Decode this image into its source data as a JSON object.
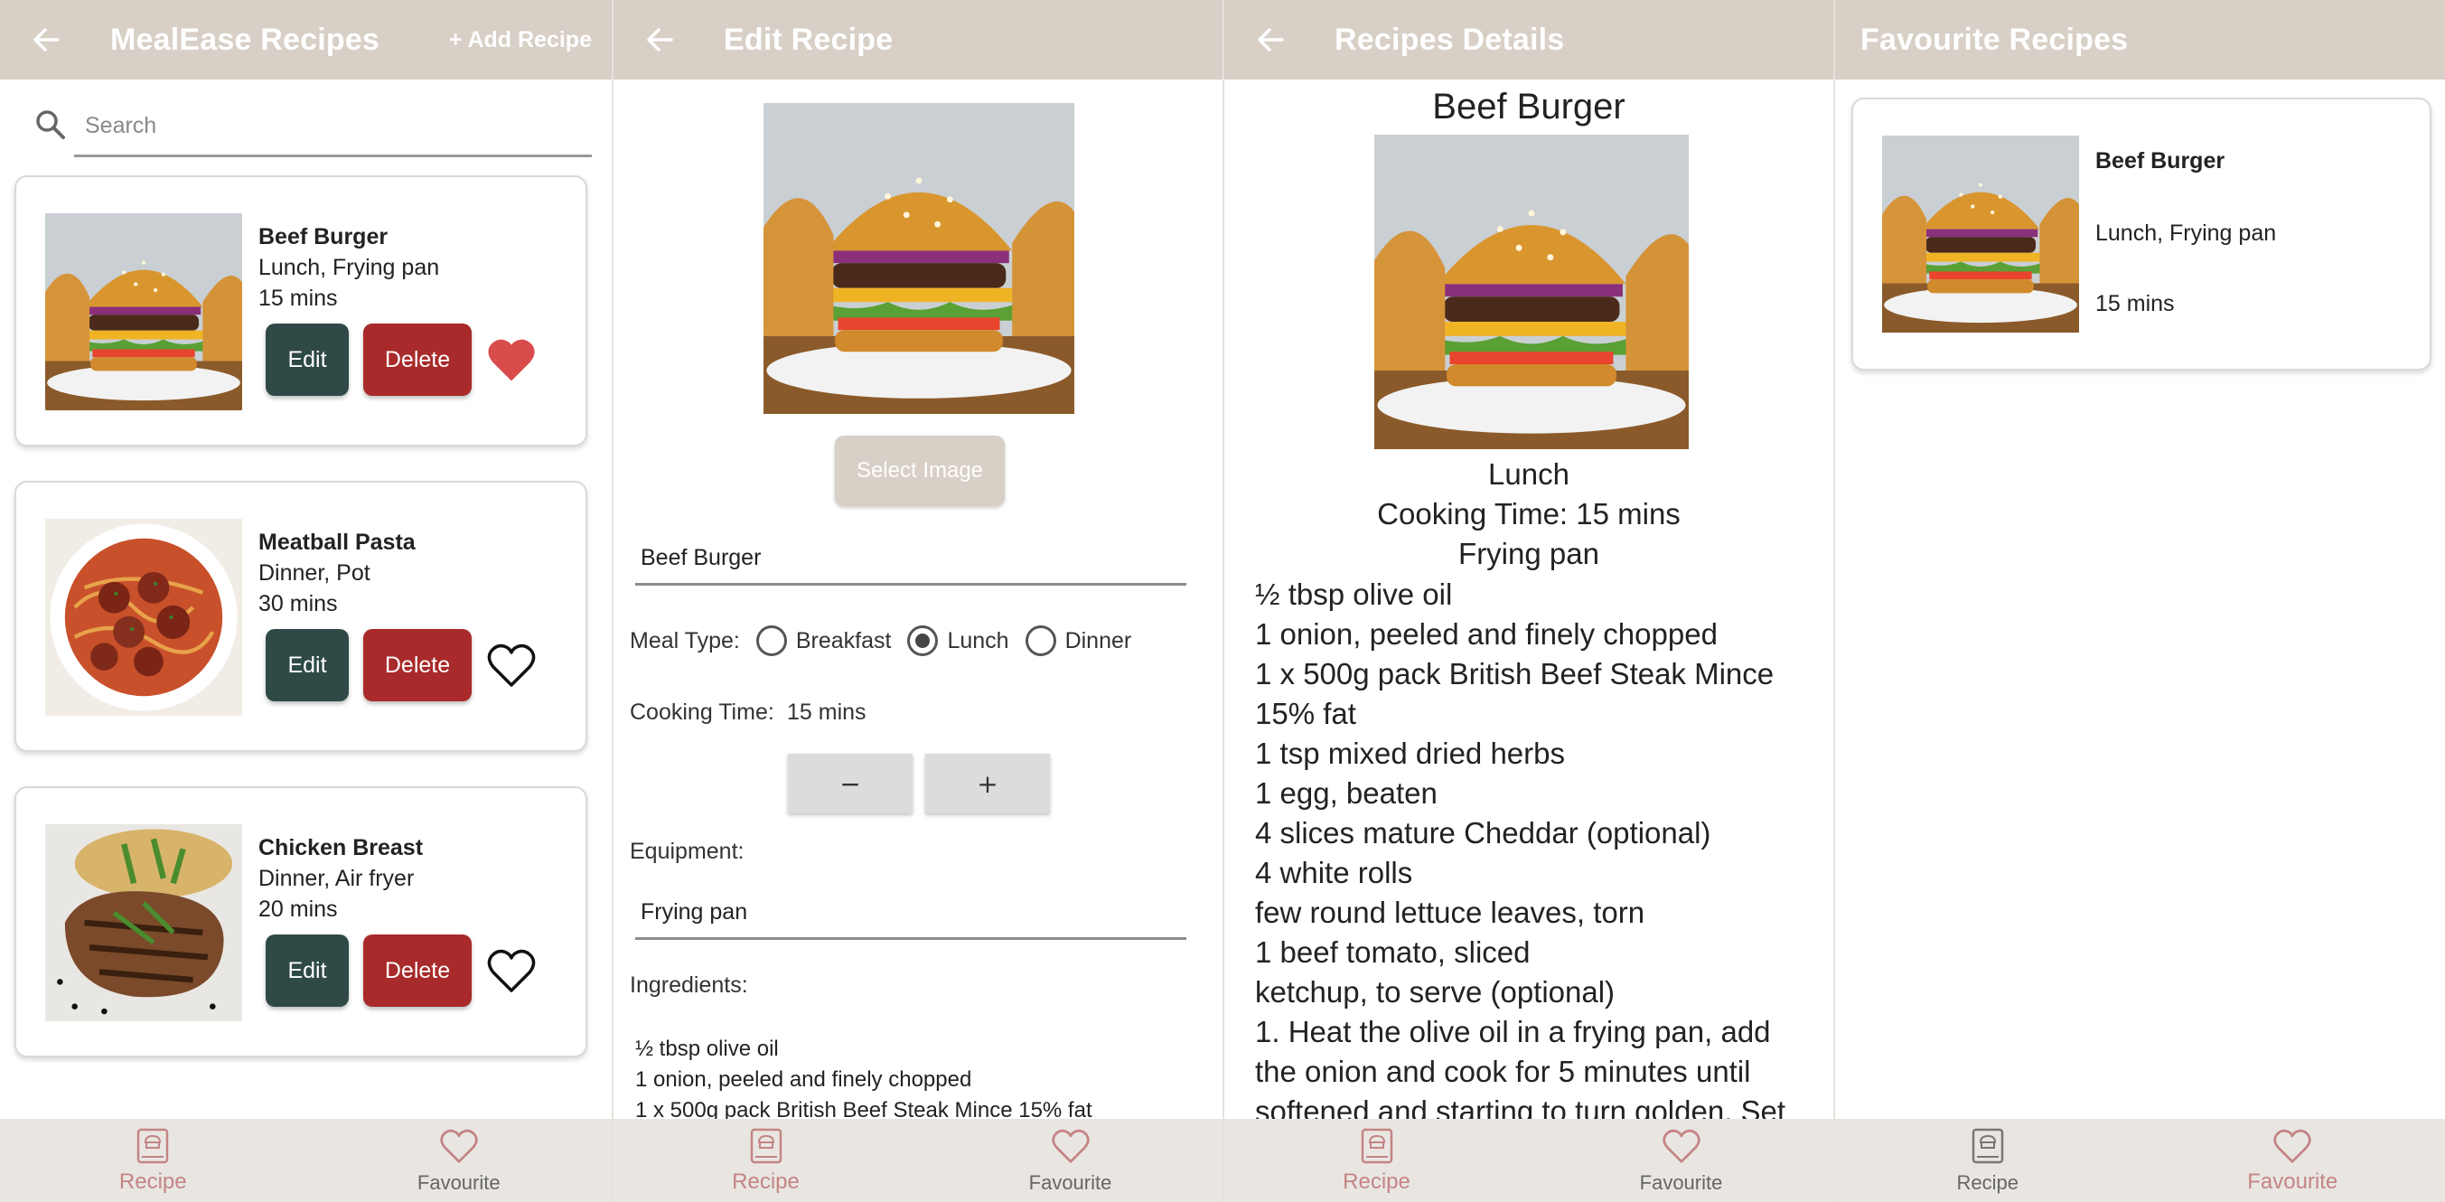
{
  "recipes_list": {
    "title": "MealEase Recipes",
    "add_label": "+ Add Recipe",
    "search_placeholder": "Search",
    "cards": [
      {
        "name": "Beef Burger",
        "meta": "Lunch, Frying pan",
        "time": "15 mins",
        "edit": "Edit",
        "delete": "Delete",
        "favourite": true
      },
      {
        "name": "Meatball Pasta",
        "meta": "Dinner, Pot",
        "time": "30 mins",
        "edit": "Edit",
        "delete": "Delete",
        "favourite": false
      },
      {
        "name": "Chicken Breast",
        "meta": "Dinner, Air fryer",
        "time": "20 mins",
        "edit": "Edit",
        "delete": "Delete",
        "favourite": false
      }
    ]
  },
  "edit": {
    "title": "Edit Recipe",
    "select_image": "Select Image",
    "name_value": "Beef Burger",
    "meal_type_label": "Meal Type:",
    "meal_options": [
      "Breakfast",
      "Lunch",
      "Dinner"
    ],
    "meal_selected": "Lunch",
    "cooking_time_label": "Cooking Time:",
    "cooking_time_value": "15 mins",
    "minus": "−",
    "plus": "+",
    "equipment_label": "Equipment:",
    "equipment_value": "Frying pan",
    "ingredients_label": "Ingredients:",
    "ingredients_lines": [
      "½ tbsp olive oil",
      "1 onion, peeled and finely chopped",
      "1 x 500g pack British Beef Steak Mince 15% fat"
    ]
  },
  "details": {
    "title": "Recipes Details",
    "recipe_name": "Beef Burger",
    "meal_type": "Lunch",
    "cooking_time": "Cooking Time: 15 mins",
    "equipment": "Frying pan",
    "lines": [
      "½ tbsp olive oil",
      "1 onion, peeled and finely chopped",
      "1 x 500g pack British Beef Steak Mince",
      "15% fat",
      "1 tsp mixed dried herbs",
      "1 egg, beaten",
      "4 slices mature Cheddar (optional)",
      "4 white rolls",
      "few round lettuce leaves, torn",
      "1 beef tomato, sliced",
      "ketchup, to serve (optional)",
      "1. Heat the olive oil in a frying pan, add",
      "the onion and cook for 5 minutes until",
      "softened and starting to turn golden. Set"
    ]
  },
  "favourites": {
    "title": "Favourite Recipes",
    "card": {
      "name": "Beef Burger",
      "meta": "Lunch, Frying pan",
      "time": "15 mins"
    }
  },
  "nav": {
    "recipe": "Recipe",
    "favourite": "Favourite"
  },
  "colors": {
    "appbar": "#d8cfc6",
    "edit_button": "#2f4a46",
    "delete_button": "#a82a2a",
    "heart": "#d94c4c",
    "active_nav": "#c48484"
  }
}
